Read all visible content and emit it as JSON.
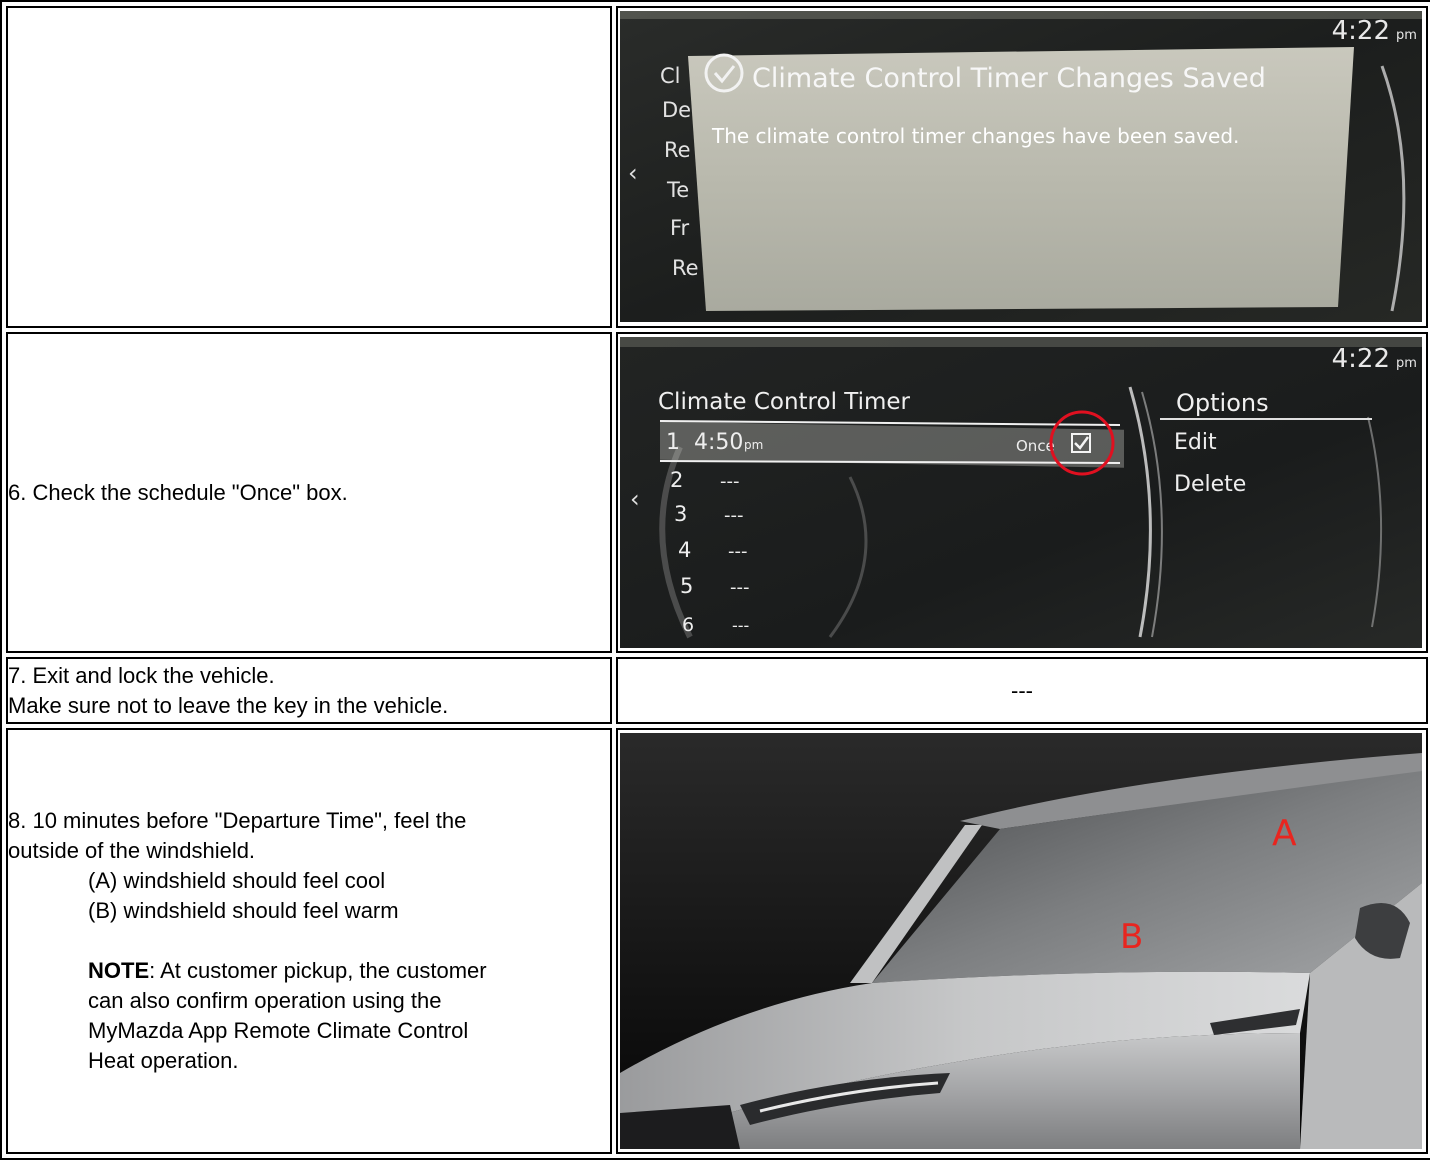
{
  "rows": [
    {
      "screen": {
        "clock": "4:22",
        "clock_suffix": "pm",
        "menu_fragments": [
          "Cl",
          "De",
          "Re",
          "Te",
          "Fr",
          "Re"
        ],
        "popup_title": "Climate Control Timer Changes Saved",
        "popup_message": "The climate control timer changes have been saved."
      }
    },
    {
      "instruction": "6. Check the schedule \"Once\" box.",
      "screen": {
        "clock": "4:22",
        "clock_suffix": "pm",
        "title": "Climate Control Timer",
        "timers": [
          {
            "num": "1",
            "time": "4:50",
            "suffix": "pm",
            "schedule": "Once"
          },
          {
            "num": "2",
            "time": "---"
          },
          {
            "num": "3",
            "time": "---"
          },
          {
            "num": "4",
            "time": "---"
          },
          {
            "num": "5",
            "time": "---"
          },
          {
            "num": "6",
            "time": "---"
          }
        ],
        "options_title": "Options",
        "options": [
          "Edit",
          "Delete"
        ],
        "highlight_color": "#e01020"
      }
    },
    {
      "instruction_lines": [
        "7. Exit and lock the vehicle.",
        "Make sure not to leave the key in the vehicle."
      ],
      "right_text": "---"
    },
    {
      "instruction_lines": [
        "8. 10 minutes before \"Departure Time\", feel the",
        "outside of the windshield."
      ],
      "sub_items": [
        "(A) windshield should feel cool",
        "(B) windshield should feel warm"
      ],
      "note_label": "NOTE",
      "note_lines": [
        ": At customer pickup, the customer",
        "can also confirm operation using the",
        "MyMazda App Remote Climate Control",
        "Heat operation."
      ],
      "image_labels": {
        "a": "A",
        "b": "B",
        "label_color": "#e8251f"
      }
    }
  ]
}
